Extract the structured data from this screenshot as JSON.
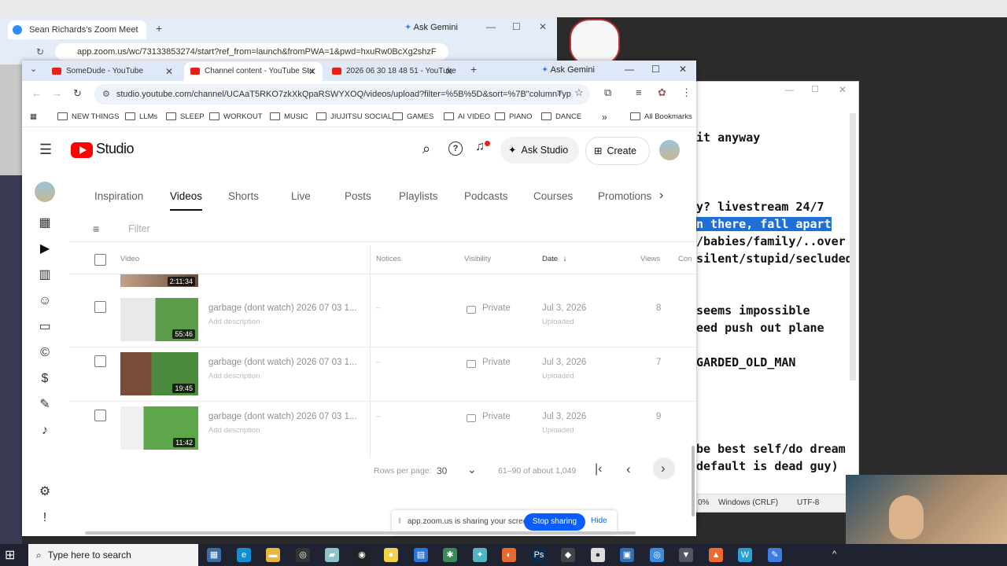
{
  "zoom_window": {
    "tab_title": "Sean Richards's Zoom Meet",
    "url": "app.zoom.us/wc/73133853274/start?ref_from=launch&fromPWA=1&pwd=hxuRw0BcXg2shzF",
    "gemini_label": "Ask Gemini"
  },
  "browser": {
    "tabs": [
      {
        "title": "SomeDude - YouTube"
      },
      {
        "title": "Channel content - YouTube Stu"
      },
      {
        "title": "2026 06 30 18 48 51 - YouTube"
      }
    ],
    "gemini_label": "Ask Gemini",
    "url": "studio.youtube.com/channel/UCAaT5RKO7zkXkQpaRSWYXOQ/videos/upload?filter=%5B%5D&sort=%7B\"columnTyp",
    "bookmarks": [
      "NEW THINGS",
      "LLMs",
      "SLEEP",
      "WORKOUT",
      "MUSIC",
      "JIUJITSU SOCIAL",
      "GAMES",
      "AI VIDEO",
      "PIANO",
      "DANCE"
    ],
    "bookmarks_overflow": "»",
    "all_bookmarks_label": "All Bookmarks"
  },
  "studio": {
    "logo_text": "Studio",
    "ask_studio_label": "Ask Studio",
    "create_label": "Create",
    "tabs": [
      "Inspiration",
      "Videos",
      "Shorts",
      "Live",
      "Posts",
      "Playlists",
      "Podcasts",
      "Courses",
      "Promotions"
    ],
    "active_tab": "Videos",
    "filter_placeholder": "Filter",
    "columns": {
      "video": "Video",
      "notices": "Notices",
      "visibility": "Visibility",
      "date": "Date",
      "views": "Views",
      "comments": "Con"
    },
    "partial_row_duration": "2:11:34",
    "videos": [
      {
        "title": "garbage (dont watch) 2026 07 03 1...",
        "description": "Add description",
        "duration": "55:46",
        "notices": "–",
        "visibility": "Private",
        "date": "Jul 3, 2026",
        "status": "Uploaded",
        "views": "8"
      },
      {
        "title": "garbage (dont watch) 2026 07 03 1...",
        "description": "Add description",
        "duration": "19:45",
        "notices": "–",
        "visibility": "Private",
        "date": "Jul 3, 2026",
        "status": "Uploaded",
        "views": "7"
      },
      {
        "title": "garbage (dont watch) 2026 07 03 1...",
        "description": "Add description",
        "duration": "11:42",
        "notices": "–",
        "visibility": "Private",
        "date": "Jul 3, 2026",
        "status": "Uploaded",
        "views": "9"
      }
    ],
    "pagination": {
      "rows_label": "Rows per page:",
      "rows_value": "30",
      "range": "61–90 of about 1,049"
    }
  },
  "share_bar": {
    "text": "app.zoom.us is sharing your screen.",
    "stop_label": "Stop sharing",
    "hide_label": "Hide"
  },
  "notepad": {
    "lines": [
      "it anyway",
      "y? livestream 24/7",
      "n there, fall apart",
      "/babies/family/..over",
      "silent/stupid/secluded",
      "seems impossible",
      "eed push out plane",
      "GARDED_OLD_MAN",
      "be best self/do dream",
      "default is dead guy)"
    ],
    "status_zoom": "0%",
    "status_eol": "Windows (CRLF)",
    "status_enc": "UTF-8"
  },
  "taskbar": {
    "search_placeholder": "Type here to search"
  },
  "colors": {
    "accent": "#0b5cff",
    "youtube_red": "#ff0000",
    "highlight": "#1e6fd6"
  }
}
